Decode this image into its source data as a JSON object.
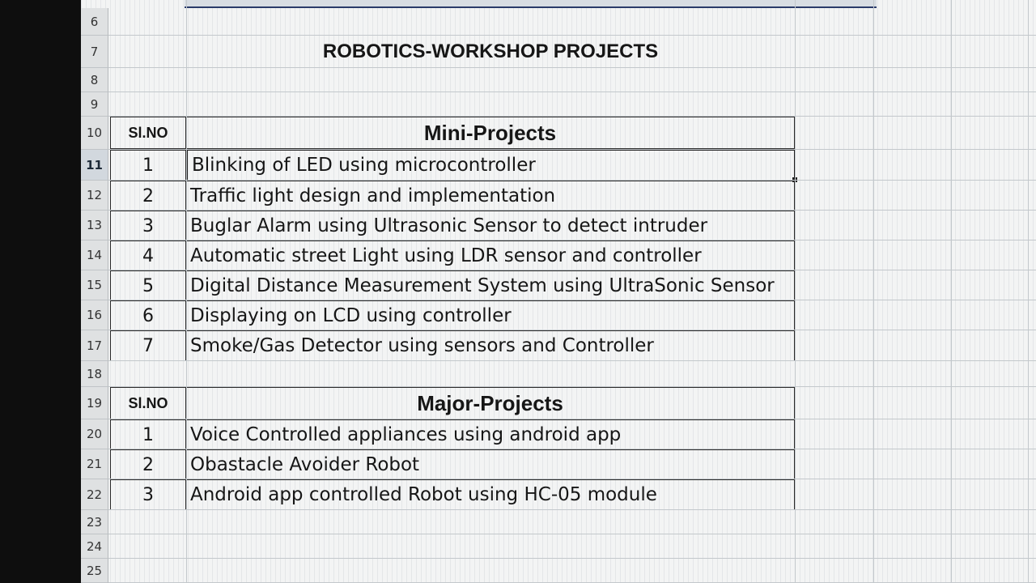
{
  "sheet": {
    "title": "ROBOTICS-WORKSHOP PROJECTS",
    "row_numbers": [
      "6",
      "7",
      "8",
      "9",
      "10",
      "11",
      "12",
      "13",
      "14",
      "15",
      "16",
      "17",
      "18",
      "19",
      "20",
      "21",
      "22",
      "23",
      "24",
      "25"
    ],
    "active_row": "11",
    "mini": {
      "sl_header": "Sl.NO",
      "header": "Mini-Projects",
      "rows": [
        {
          "no": "1",
          "name": "Blinking of LED using microcontroller"
        },
        {
          "no": "2",
          "name": "Traffic light design and implementation"
        },
        {
          "no": "3",
          "name": "Buglar Alarm using Ultrasonic Sensor to detect intruder"
        },
        {
          "no": "4",
          "name": "Automatic street Light using LDR sensor and controller"
        },
        {
          "no": "5",
          "name": "Digital Distance Measurement System using UltraSonic Sensor"
        },
        {
          "no": "6",
          "name": "Displaying on LCD using controller"
        },
        {
          "no": "7",
          "name": "Smoke/Gas Detector using sensors and Controller"
        }
      ]
    },
    "major": {
      "sl_header": "Sl.NO",
      "header": "Major-Projects",
      "rows": [
        {
          "no": "1",
          "name": "Voice Controlled appliances using android app"
        },
        {
          "no": "2",
          "name": "Obastacle Avoider Robot"
        },
        {
          "no": "3",
          "name": "Android app controlled Robot using HC-05 module"
        }
      ]
    }
  }
}
